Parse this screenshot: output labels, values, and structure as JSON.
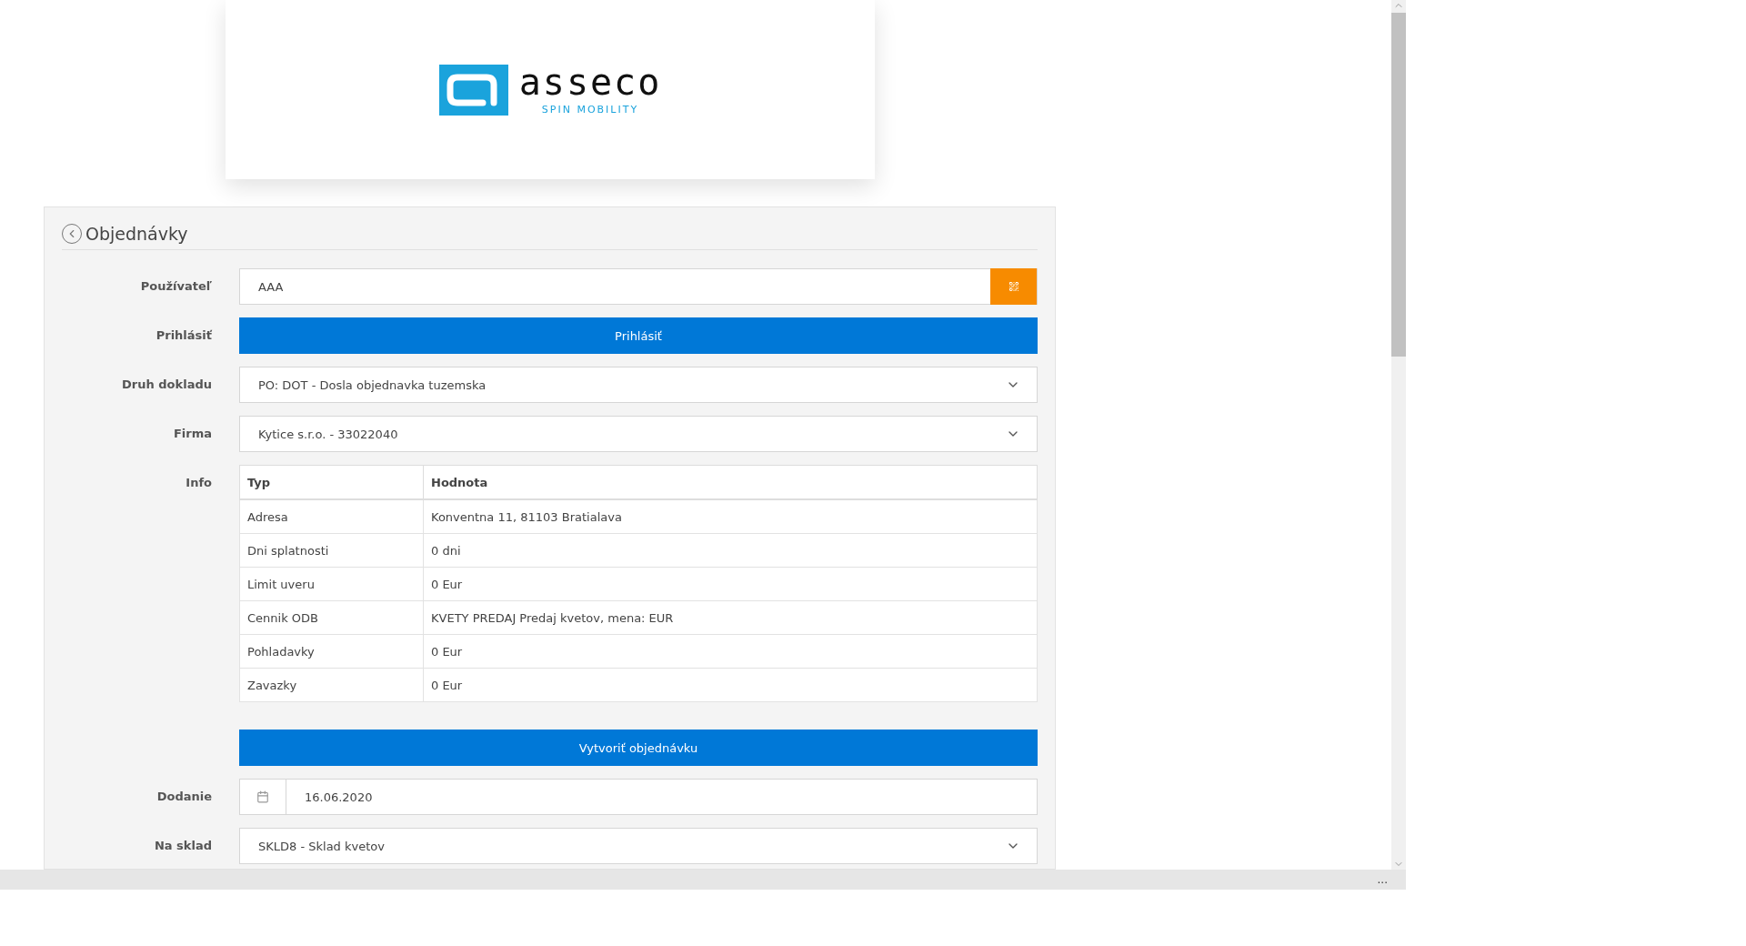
{
  "logo": {
    "wordmark": "asseco",
    "tagline": "SPIN MOBILITY"
  },
  "header": {
    "title": "Objednávky"
  },
  "user": {
    "label": "Používateľ",
    "value": "AAA"
  },
  "login": {
    "label": "Prihlásiť",
    "button": "Prihlásiť"
  },
  "doc_type": {
    "label": "Druh dokladu",
    "value": "PO: DOT - Dosla objednavka tuzemska"
  },
  "company": {
    "label": "Firma",
    "value": "Kytice s.r.o. - 33022040"
  },
  "info": {
    "label": "Info",
    "columns": [
      "Typ",
      "Hodnota"
    ],
    "rows": [
      [
        "Adresa",
        "Konventna 11, 81103 Bratialava"
      ],
      [
        "Dni splatnosti",
        "0 dni"
      ],
      [
        "Limit uveru",
        "0 Eur"
      ],
      [
        "Cennik ODB",
        "KVETY PREDAJ Predaj kvetov, mena: EUR"
      ],
      [
        "Pohladavky",
        "0 Eur"
      ],
      [
        "Zavazky",
        "0 Eur"
      ]
    ]
  },
  "create": {
    "button": "Vytvoriť objednávku"
  },
  "delivery": {
    "label": "Dodanie",
    "value": "16.06.2020"
  },
  "warehouse": {
    "label": "Na sklad",
    "value": "SKLD8 - Sklad kvetov"
  },
  "status_bar": {
    "text": "..."
  }
}
